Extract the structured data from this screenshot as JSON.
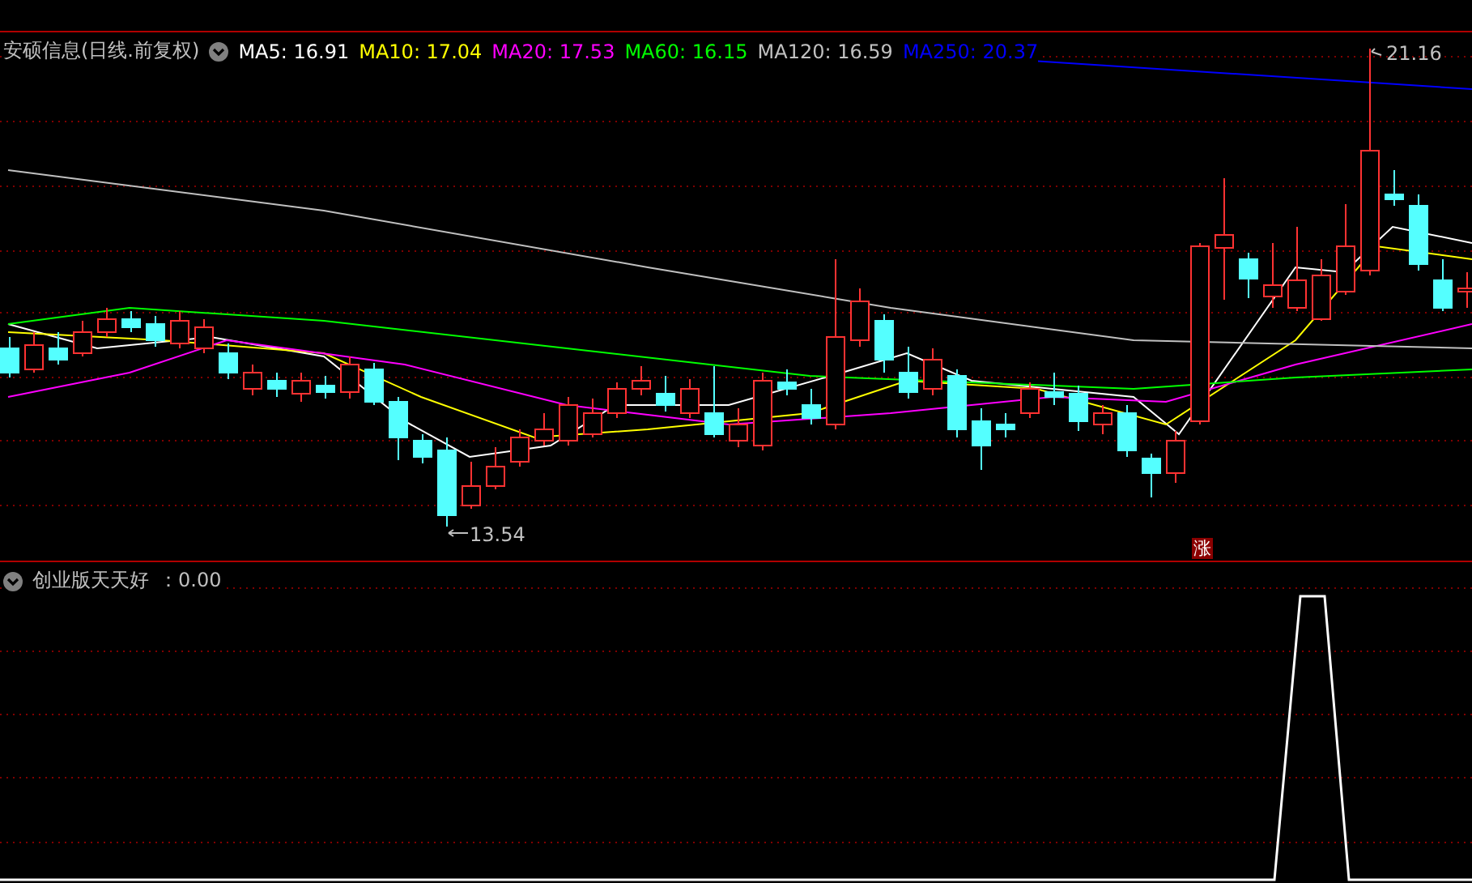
{
  "chart_header": {
    "title": "安硕信息(日线.前复权)",
    "moving_averages": [
      {
        "label": "MA5: 16.91",
        "color": "#ffffff"
      },
      {
        "label": "MA10: 17.04",
        "color": "#ffff00"
      },
      {
        "label": "MA20: 17.53",
        "color": "#ff00ff"
      },
      {
        "label": "MA60: 16.15",
        "color": "#00ff00"
      },
      {
        "label": "MA120: 16.59",
        "color": "#c0c0c0"
      },
      {
        "label": "MA250: 20.37",
        "color": "#0000ff"
      }
    ]
  },
  "price_chart": {
    "high_label": "21.16",
    "low_label": "13.54",
    "badge": "涨"
  },
  "indicator_panel": {
    "title": "创业版天天好",
    "value": "：0.00"
  }
}
